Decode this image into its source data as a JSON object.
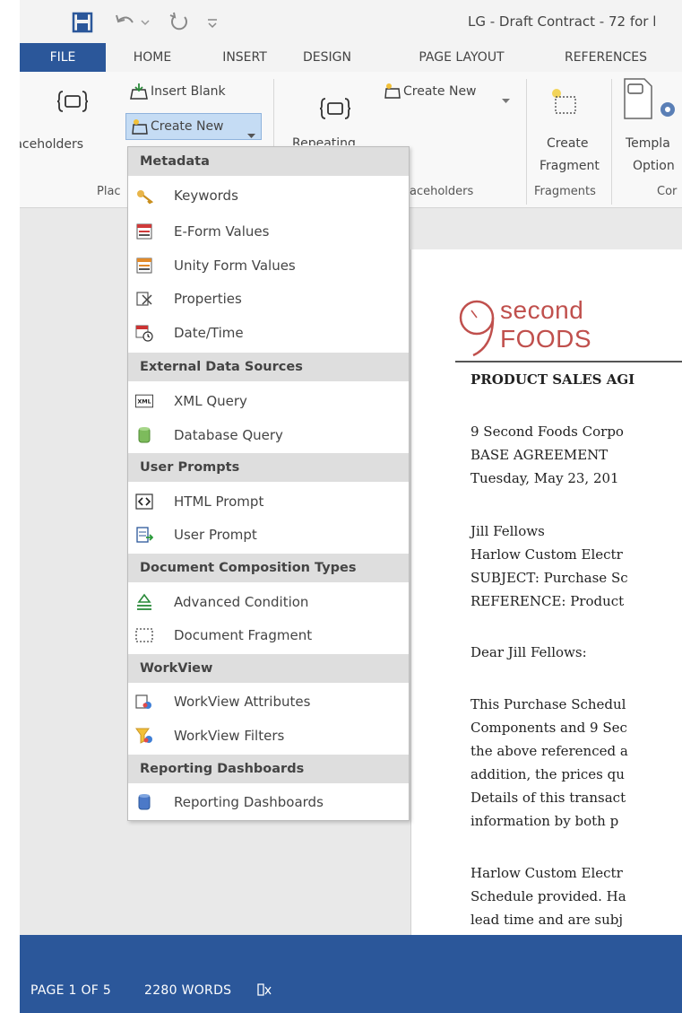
{
  "window": {
    "title": "LG - Draft Contract - 72 for l"
  },
  "ribbon_tabs": [
    "FILE",
    "HOME",
    "INSERT",
    "DESIGN",
    "PAGE LAYOUT",
    "REFERENCES"
  ],
  "ribbon": {
    "insert_blank": "Insert Blank",
    "create_new_main": "Create New",
    "create_new_right": "Create New",
    "placeholders": "Placeholders",
    "repeating": "Repeating",
    "create_fragment_line1": "Create",
    "create_fragment_line2": "Fragment",
    "template_options_line1": "Templa",
    "template_options_line2": "Option",
    "groups": {
      "plac": "Plac",
      "placeholders2": "aceholders",
      "fragments": "Fragments",
      "cor": "Cor"
    }
  },
  "menu": {
    "sections": [
      {
        "title": "Metadata",
        "items": [
          "Keywords",
          "E-Form Values",
          "Unity Form Values",
          "Properties",
          "Date/Time"
        ]
      },
      {
        "title": "External Data Sources",
        "items": [
          "XML Query",
          "Database Query"
        ]
      },
      {
        "title": "User Prompts",
        "items": [
          "HTML Prompt",
          "User Prompt"
        ]
      },
      {
        "title": "Document Composition Types",
        "items": [
          "Advanced Condition",
          "Document Fragment"
        ]
      },
      {
        "title": "WorkView",
        "items": [
          "WorkView Attributes",
          "WorkView Filters"
        ]
      },
      {
        "title": "Reporting Dashboards",
        "items": [
          "Reporting Dashboards"
        ]
      }
    ]
  },
  "document": {
    "logo_top": "second",
    "logo_bottom": "FOODS",
    "logo_nine": "9",
    "heading": "PRODUCT SALES AGI",
    "lines": [
      "9 Second Foods Corpo",
      "BASE AGREEMENT",
      "Tuesday, May 23, 201",
      "Jill Fellows",
      "Harlow Custom Electr",
      "SUBJECT: Purchase Sc",
      "REFERENCE: Product",
      "Dear Jill Fellows:",
      "This Purchase Schedul",
      "Components and 9 Sec",
      "the above referenced a",
      "addition, the prices qu",
      "Details of this transact",
      "information by both p",
      "Harlow Custom Electr",
      "Schedule provided. Ha",
      "lead time and are subj"
    ]
  },
  "status": {
    "page": "PAGE 1 OF 5",
    "words": "2280 WORDS"
  },
  "colors": {
    "accent": "#2b579a",
    "logo": "#c0504d",
    "menu_section_bg": "#dedede"
  }
}
